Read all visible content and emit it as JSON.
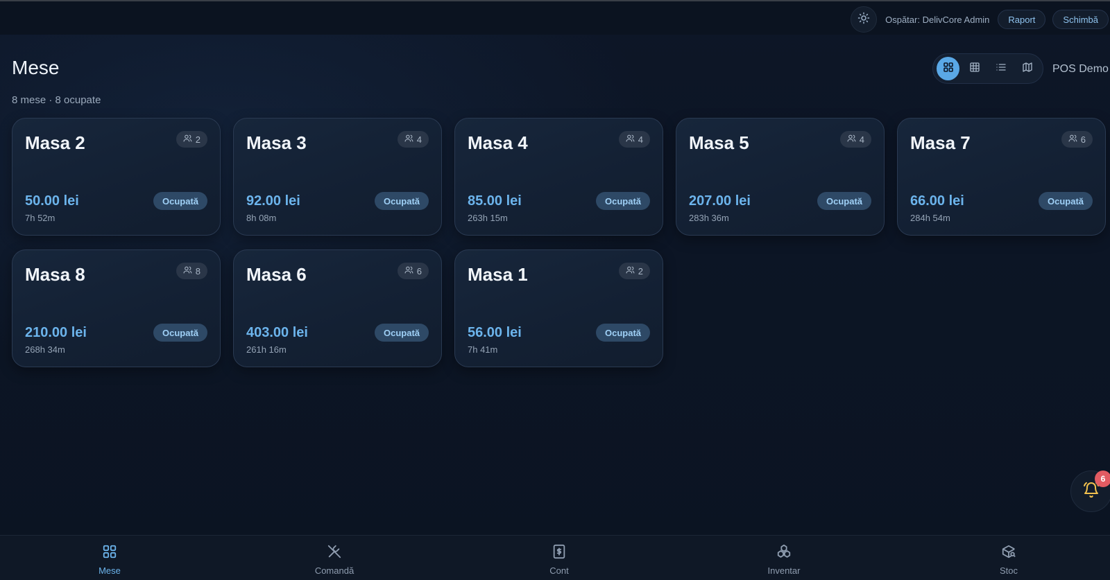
{
  "topbar": {
    "waiter_label": "Ospătar: DelivCore Admin",
    "report_label": "Raport",
    "switch_label": "Schimbă"
  },
  "header": {
    "title": "Mese",
    "subtitle": "8 mese · 8 ocupate",
    "pos_label": "POS Demo",
    "views": [
      "grid-view-icon",
      "table-view-icon",
      "list-view-icon",
      "map-view-icon"
    ],
    "active_view": "grid-view-icon"
  },
  "tables": [
    {
      "name": "Masa 2",
      "seats": "2",
      "amount": "50.00 lei",
      "duration": "7h 52m",
      "status": "Ocupată"
    },
    {
      "name": "Masa 3",
      "seats": "4",
      "amount": "92.00 lei",
      "duration": "8h 08m",
      "status": "Ocupată"
    },
    {
      "name": "Masa 4",
      "seats": "4",
      "amount": "85.00 lei",
      "duration": "263h 15m",
      "status": "Ocupată"
    },
    {
      "name": "Masa 5",
      "seats": "4",
      "amount": "207.00 lei",
      "duration": "283h 36m",
      "status": "Ocupată"
    },
    {
      "name": "Masa 7",
      "seats": "6",
      "amount": "66.00 lei",
      "duration": "284h 54m",
      "status": "Ocupată"
    },
    {
      "name": "Masa 8",
      "seats": "8",
      "amount": "210.00 lei",
      "duration": "268h 34m",
      "status": "Ocupată"
    },
    {
      "name": "Masa 6",
      "seats": "6",
      "amount": "403.00 lei",
      "duration": "261h 16m",
      "status": "Ocupată"
    },
    {
      "name": "Masa 1",
      "seats": "2",
      "amount": "56.00 lei",
      "duration": "7h 41m",
      "status": "Ocupată"
    }
  ],
  "notifications": {
    "count": "6",
    "icon": "bell-icon"
  },
  "nav": [
    {
      "label": "Mese",
      "icon": "tables-icon",
      "active": true
    },
    {
      "label": "Comandă",
      "icon": "utensils-icon",
      "active": false
    },
    {
      "label": "Cont",
      "icon": "bill-icon",
      "active": false
    },
    {
      "label": "Inventar",
      "icon": "inventory-icon",
      "active": false
    },
    {
      "label": "Stoc",
      "icon": "stock-icon",
      "active": false
    }
  ],
  "colors": {
    "background": "#0c1524",
    "accent": "#6cb4ec",
    "card": "#152337",
    "status_badge": "#2e4966",
    "notification_badge": "#e25b62",
    "bell": "#f2c14e"
  }
}
